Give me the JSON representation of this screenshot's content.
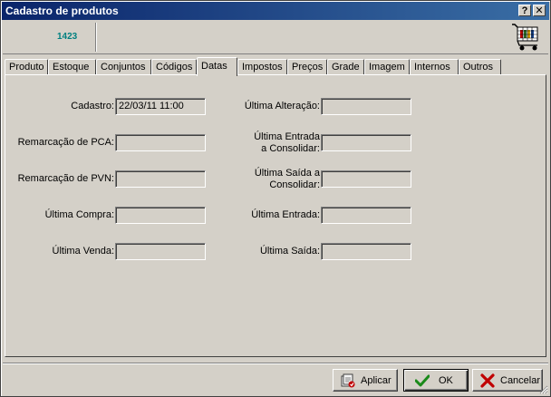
{
  "window": {
    "title": "Cadastro de produtos",
    "help_label": "?",
    "close_label": "✕"
  },
  "product": {
    "code": "1423"
  },
  "tabs": [
    {
      "label": "Produto"
    },
    {
      "label": "Estoque"
    },
    {
      "label": "Conjuntos"
    },
    {
      "label": "Códigos"
    },
    {
      "label": "Datas"
    },
    {
      "label": "Impostos"
    },
    {
      "label": "Preços"
    },
    {
      "label": "Grade"
    },
    {
      "label": "Imagem"
    },
    {
      "label": "Internos"
    },
    {
      "label": "Outros"
    }
  ],
  "active_tab": "Datas",
  "dates": {
    "cadastro": {
      "label": "Cadastro:",
      "value": "22/03/11 11:00"
    },
    "remarcacao_pca": {
      "label": "Remarcação de PCA:",
      "value": ""
    },
    "remarcacao_pvn": {
      "label": "Remarcação de PVN:",
      "value": ""
    },
    "ultima_compra": {
      "label": "Última Compra:",
      "value": ""
    },
    "ultima_venda": {
      "label": "Última Venda:",
      "value": ""
    },
    "ultima_alteracao": {
      "label": "Última Alteração:",
      "value": ""
    },
    "ultima_entrada_consolidar": {
      "label_line1": "Última Entrada",
      "label_line2": "a Consolidar:",
      "value": ""
    },
    "ultima_saida_consolidar": {
      "label_line1": "Última Saída a",
      "label_line2": "Consolidar:",
      "value": ""
    },
    "ultima_entrada": {
      "label": "Última Entrada:",
      "value": ""
    },
    "ultima_saida": {
      "label": "Última Saída:",
      "value": ""
    }
  },
  "buttons": {
    "apply": "Aplicar",
    "ok": "OK",
    "cancel": "Cancelar"
  },
  "icons": {
    "header": "shopping-cart-icon",
    "apply": "apply-icon",
    "ok": "checkmark-icon",
    "cancel": "cross-icon"
  },
  "colors": {
    "title_start": "#0a246a",
    "title_end": "#3a6ea5",
    "code_text": "#008080",
    "ok_check": "#1a8a1a",
    "cancel_x": "#c00000"
  }
}
